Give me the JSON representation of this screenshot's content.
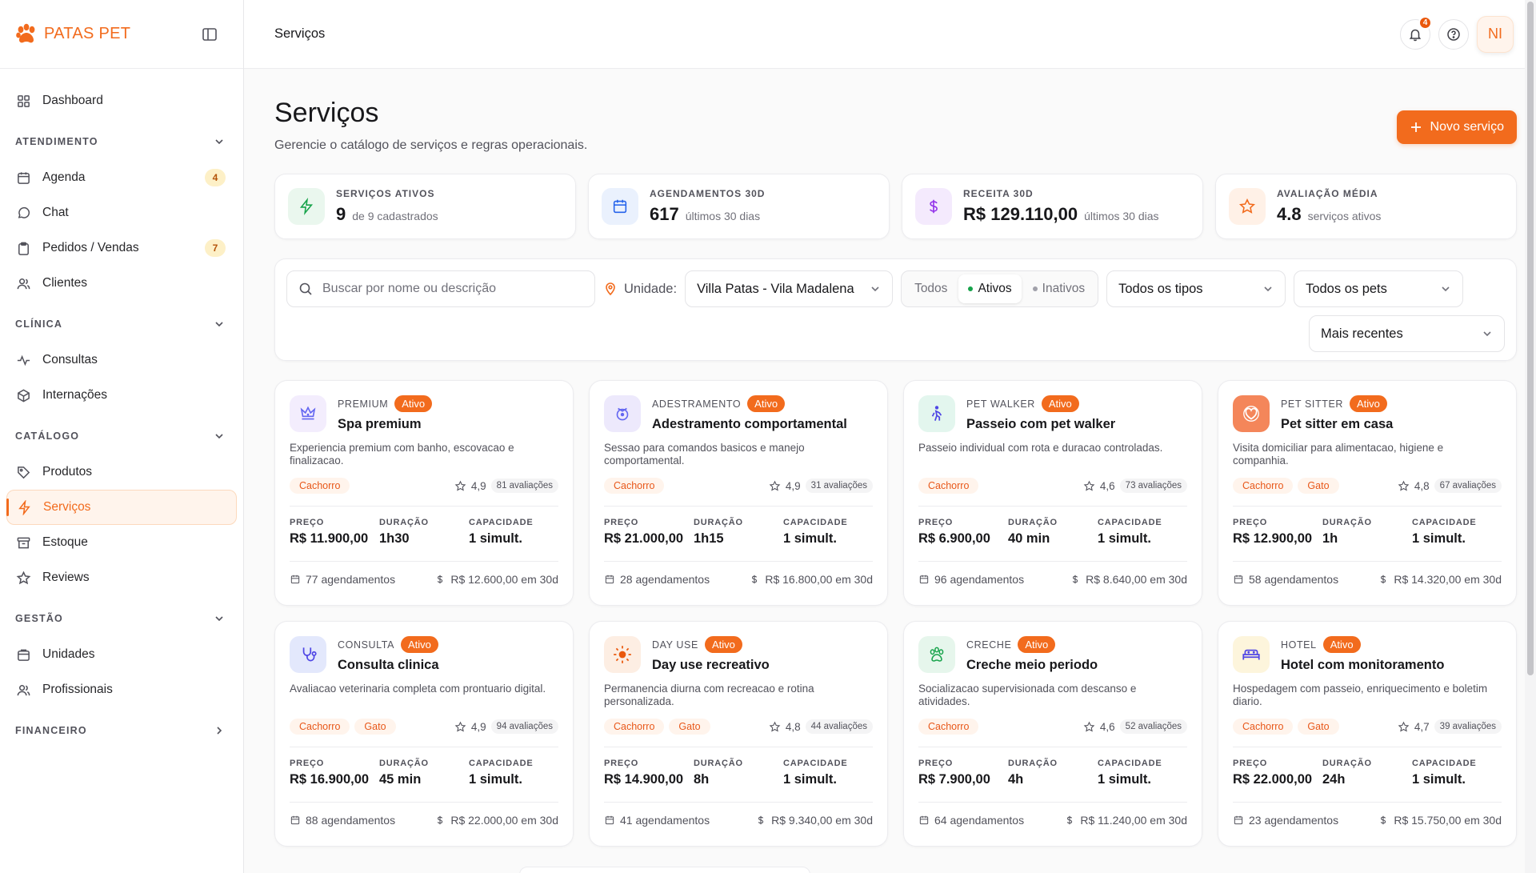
{
  "brand": {
    "name": "PATAS PET",
    "accent": "#f26b1d"
  },
  "sidebar": {
    "items": [
      {
        "label": "Dashboard",
        "icon": "grid-icon"
      },
      {
        "section": "ATENDIMENTO"
      },
      {
        "label": "Agenda",
        "icon": "calendar-icon",
        "badge": "4"
      },
      {
        "label": "Chat",
        "icon": "chat-icon"
      },
      {
        "label": "Pedidos / Vendas",
        "icon": "clipboard-icon",
        "badge": "7"
      },
      {
        "label": "Clientes",
        "icon": "users-icon"
      },
      {
        "section": "CLÍNICA"
      },
      {
        "label": "Consultas",
        "icon": "activity-icon"
      },
      {
        "label": "Internações",
        "icon": "box-icon"
      },
      {
        "section": "CATÁLOGO"
      },
      {
        "label": "Produtos",
        "icon": "tag-icon"
      },
      {
        "label": "Serviços",
        "icon": "zap-icon",
        "active": true
      },
      {
        "label": "Estoque",
        "icon": "archive-icon"
      },
      {
        "label": "Reviews",
        "icon": "star-icon"
      },
      {
        "section": "GESTÃO"
      },
      {
        "label": "Unidades",
        "icon": "store-icon"
      },
      {
        "label": "Profissionais",
        "icon": "users-icon"
      },
      {
        "section": "FINANCEIRO"
      }
    ]
  },
  "topbar": {
    "breadcrumb": "Serviços",
    "notifications": "4",
    "avatar": "NI"
  },
  "page": {
    "title": "Serviços",
    "subtitle": "Gerencie o catálogo de serviços e regras operacionais.",
    "new_button": "Novo serviço"
  },
  "stats": [
    {
      "label": "SERVIÇOS ATIVOS",
      "value": "9",
      "sub": "de 9 cadastrados",
      "icon": "zap-icon",
      "color": "#16a34a",
      "bg": "#eaf7ee"
    },
    {
      "label": "AGENDAMENTOS 30D",
      "value": "617",
      "sub": "últimos 30 dias",
      "icon": "calendar-icon",
      "color": "#2563eb",
      "bg": "#eaf1fd"
    },
    {
      "label": "RECEITA 30D",
      "value": "R$ 129.110,00",
      "sub": "últimos 30 dias",
      "icon": "dollar-icon",
      "color": "#9333ea",
      "bg": "#f4eafd"
    },
    {
      "label": "AVALIAÇÃO MÉDIA",
      "value": "4.8",
      "sub": "serviços ativos",
      "icon": "star-icon",
      "color": "#f26b1d",
      "bg": "#fff1e7"
    }
  ],
  "filters": {
    "search_placeholder": "Buscar por nome ou descrição",
    "unit_label": "Unidade:",
    "unit_value": "Villa Patas - Vila Madalena",
    "status_options": [
      "Todos",
      "Ativos",
      "Inativos"
    ],
    "status_selected": "Ativos",
    "type_value": "Todos os tipos",
    "pet_value": "Todos os pets",
    "sort_value": "Mais recentes"
  },
  "labels": {
    "price": "PREÇO",
    "duration": "DURAÇÃO",
    "capacity": "CAPACIDADE",
    "active": "Ativo"
  },
  "services": [
    {
      "category": "PREMIUM",
      "title": "Spa premium",
      "desc": "Experiencia premium com banho, escovacao e finalizacao.",
      "tags": [
        "Cachorro"
      ],
      "rating": "4,9",
      "reviews": "81 avaliações",
      "price": "R$ 11.900,00",
      "duration": "1h30",
      "capacity": "1 simult.",
      "bookings": "77 agendamentos",
      "revenue": "R$ 12.600,00 em 30d",
      "icon": "crown-icon",
      "icon_color": "#6366f1",
      "icon_bg": "#f3edfd"
    },
    {
      "category": "ADESTRAMENTO",
      "title": "Adestramento comportamental",
      "desc": "Sessao para comandos basicos e manejo comportamental.",
      "tags": [
        "Cachorro"
      ],
      "rating": "4,9",
      "reviews": "31 avaliações",
      "price": "R$ 21.000,00",
      "duration": "1h15",
      "capacity": "1 simult.",
      "bookings": "28 agendamentos",
      "revenue": "R$ 16.800,00 em 30d",
      "icon": "whistle-icon",
      "icon_color": "#6366f1",
      "icon_bg": "#ede9fc"
    },
    {
      "category": "PET WALKER",
      "title": "Passeio com pet walker",
      "desc": "Passeio individual com rota e duracao controladas.",
      "tags": [
        "Cachorro"
      ],
      "rating": "4,6",
      "reviews": "73 avaliações",
      "price": "R$ 6.900,00",
      "duration": "40 min",
      "capacity": "1 simult.",
      "bookings": "96 agendamentos",
      "revenue": "R$ 8.640,00 em 30d",
      "icon": "walker-icon",
      "icon_color": "#4f46e5",
      "icon_bg": "#e3f6ee"
    },
    {
      "category": "PET SITTER",
      "title": "Pet sitter em casa",
      "desc": "Visita domiciliar para alimentacao, higiene e companhia.",
      "tags": [
        "Cachorro",
        "Gato"
      ],
      "rating": "4,8",
      "reviews": "67 avaliações",
      "price": "R$ 12.900,00",
      "duration": "1h",
      "capacity": "1 simult.",
      "bookings": "58 agendamentos",
      "revenue": "R$ 14.320,00 em 30d",
      "icon": "heart-hand-icon",
      "icon_color": "#ffffff",
      "icon_bg": "#f4865a"
    },
    {
      "category": "CONSULTA",
      "title": "Consulta clinica",
      "desc": "Avaliacao veterinaria completa com prontuario digital.",
      "tags": [
        "Cachorro",
        "Gato"
      ],
      "rating": "4,9",
      "reviews": "94 avaliações",
      "price": "R$ 16.900,00",
      "duration": "45 min",
      "capacity": "1 simult.",
      "bookings": "88 agendamentos",
      "revenue": "R$ 22.000,00 em 30d",
      "icon": "stethoscope-icon",
      "icon_color": "#4f46e5",
      "icon_bg": "#e3e8fc"
    },
    {
      "category": "DAY USE",
      "title": "Day use recreativo",
      "desc": "Permanencia diurna com recreacao e rotina personalizada.",
      "tags": [
        "Cachorro",
        "Gato"
      ],
      "rating": "4,8",
      "reviews": "44 avaliações",
      "price": "R$ 14.900,00",
      "duration": "8h",
      "capacity": "1 simult.",
      "bookings": "41 agendamentos",
      "revenue": "R$ 9.340,00 em 30d",
      "icon": "sun-icon",
      "icon_color": "#ea580c",
      "icon_bg": "#fdeee3"
    },
    {
      "category": "CRECHE",
      "title": "Creche meio periodo",
      "desc": "Socializacao supervisionada com descanso e atividades.",
      "tags": [
        "Cachorro"
      ],
      "rating": "4,6",
      "reviews": "52 avaliações",
      "price": "R$ 7.900,00",
      "duration": "4h",
      "capacity": "1 simult.",
      "bookings": "64 agendamentos",
      "revenue": "R$ 11.240,00 em 30d",
      "icon": "paw-icon",
      "icon_color": "#16a34a",
      "icon_bg": "#e6f6ec"
    },
    {
      "category": "HOTEL",
      "title": "Hotel com monitoramento",
      "desc": "Hospedagem com passeio, enriquecimento e boletim diario.",
      "tags": [
        "Cachorro",
        "Gato"
      ],
      "rating": "4,7",
      "reviews": "39 avaliações",
      "price": "R$ 22.000,00",
      "duration": "24h",
      "capacity": "1 simult.",
      "bookings": "23 agendamentos",
      "revenue": "R$ 15.750,00 em 30d",
      "icon": "bed-icon",
      "icon_color": "#4f46e5",
      "icon_bg": "#fdf5dc"
    }
  ]
}
